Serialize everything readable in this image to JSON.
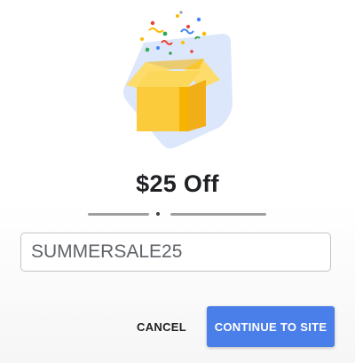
{
  "dialog": {
    "illustration": "gift-box-confetti",
    "title": "$25 Off",
    "code_value": "SUMMERSALE25",
    "cancel_label": "CANCEL",
    "continue_label": "CONTINUE TO SITE"
  },
  "colors": {
    "accent": "#4a7ee8",
    "box": "#fccb3c",
    "box_shadow_bg": "#dce7fb",
    "title_text": "#202124"
  }
}
